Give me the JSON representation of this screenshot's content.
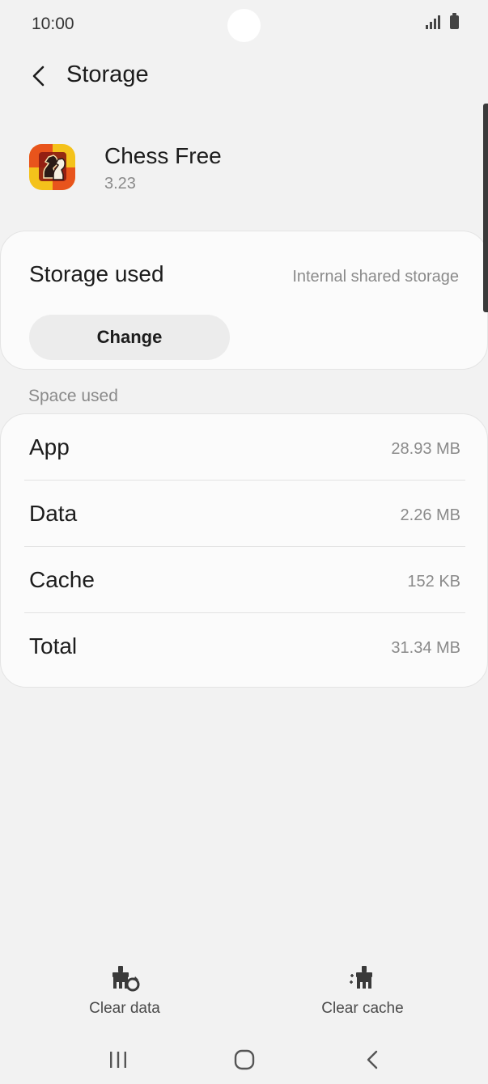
{
  "status_bar": {
    "time": "10:00",
    "icons": [
      "signal-icon",
      "battery-icon"
    ]
  },
  "header": {
    "back_icon": "back-arrow-icon",
    "title": "Storage"
  },
  "app": {
    "name": "Chess Free",
    "version": "3.23",
    "icon": "chess-app-icon"
  },
  "storage": {
    "label": "Storage used",
    "location": "Internal shared storage",
    "change_label": "Change"
  },
  "space_used": {
    "section_label": "Space used",
    "rows": [
      {
        "label": "App",
        "value": "28.93 MB"
      },
      {
        "label": "Data",
        "value": "2.26 MB"
      },
      {
        "label": "Cache",
        "value": "152 KB"
      },
      {
        "label": "Total",
        "value": "31.34 MB"
      }
    ]
  },
  "actions": {
    "clear_data": "Clear data",
    "clear_cache": "Clear cache"
  },
  "nav": {
    "icons": [
      "recents-icon",
      "home-icon",
      "back-icon"
    ]
  },
  "colors": {
    "background": "#f2f2f2",
    "card": "#fbfbfb",
    "text_primary": "#1c1c1c",
    "text_secondary": "#8a8a8a",
    "button": "#ececec"
  }
}
